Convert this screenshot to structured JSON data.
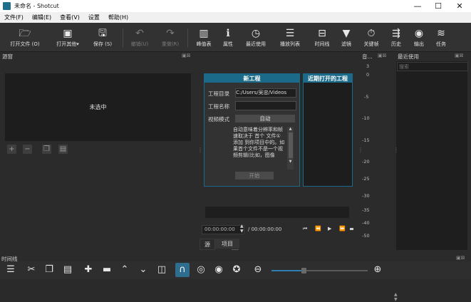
{
  "window": {
    "title": "未命名 - Shotcut",
    "minimize": "—",
    "maximize": "☐",
    "close": "✕"
  },
  "menu": [
    "文件(F)",
    "编辑(E)",
    "查看(V)",
    "设置",
    "帮助(H)"
  ],
  "toolbar": {
    "open_file": "打开文件 (O)",
    "open_other": "打开其他",
    "save": "保存 (S)",
    "undo": "撤销(U)",
    "redo": "重做(R)",
    "peak": "峰值表",
    "properties": "属性",
    "recent": "最近使用",
    "playlist": "播放列表",
    "timeline": "时间线",
    "filters": "滤镜",
    "keyframes": "关键帧",
    "history": "历史",
    "export": "输出",
    "jobs": "任务"
  },
  "source": {
    "title": "源窗",
    "status": "未选中"
  },
  "new_project": {
    "title": "新工程",
    "dir_label": "工程目录",
    "dir_value": "C:/Users/吴忠/Videos",
    "name_label": "工程名称",
    "name_value": "",
    "video_mode_label": "视频模式",
    "video_mode_value": "自动",
    "description": "自动意味着分辨率和帧速取决于 首个 文件① 添加 到你项目中的。如果首个文件不是一个视频剪辑(比如，图像",
    "start_button": "开始"
  },
  "recent_projects": {
    "title": "近期打开的工程"
  },
  "audio": {
    "title": "音...",
    "scale": [
      "3",
      "0",
      "-5",
      "-10",
      "-15",
      "-20",
      "-25",
      "-30",
      "-35",
      "-40",
      "-50"
    ]
  },
  "recent_panel": {
    "title": "最近使用",
    "search_placeholder": "搜索"
  },
  "transport": {
    "position": "00:00:00:00",
    "duration": "/ 00:00:00:00"
  },
  "tabs": {
    "source": "源",
    "project": "项目"
  },
  "timeline": {
    "title": "时间线"
  },
  "colors": {
    "accent": "#1c6a8a",
    "snap_active": "#2f6d8f",
    "background": "#2b2b2b"
  }
}
